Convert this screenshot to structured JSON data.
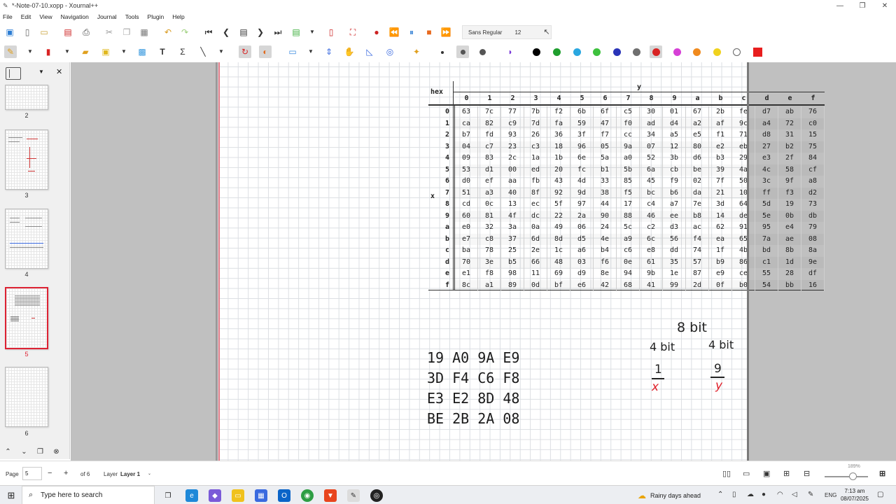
{
  "window": {
    "title": "*-Note-07-10.xopp - Xournal++"
  },
  "menu": [
    "File",
    "Edit",
    "View",
    "Navigation",
    "Journal",
    "Tools",
    "Plugin",
    "Help"
  ],
  "toolbar": {
    "font_name": "Sans Regular",
    "font_size": "12",
    "colors": [
      "#000000",
      "#1f9e2e",
      "#2aa7e0",
      "#3ec13e",
      "#2a34b8",
      "#6f6f6f",
      "#d82323",
      "#d640d6",
      "#f08a1e",
      "#f0d21e",
      "#ffffff"
    ],
    "fill_color": "#e81e1e",
    "selected_color": "#d82323"
  },
  "sidebar": {
    "pages": [
      {
        "num": "2"
      },
      {
        "num": "3"
      },
      {
        "num": "4"
      },
      {
        "num": "5",
        "selected": true
      },
      {
        "num": "6"
      }
    ]
  },
  "sbox": {
    "title": "hex",
    "y_label": "y",
    "x_label": "x",
    "cols": [
      "0",
      "1",
      "2",
      "3",
      "4",
      "5",
      "6",
      "7",
      "8",
      "9",
      "a",
      "b",
      "c",
      "d",
      "e",
      "f"
    ],
    "rows": [
      {
        "h": "0",
        "v": [
          "63",
          "7c",
          "77",
          "7b",
          "f2",
          "6b",
          "6f",
          "c5",
          "30",
          "01",
          "67",
          "2b",
          "fe",
          "d7",
          "ab",
          "76"
        ]
      },
      {
        "h": "1",
        "v": [
          "ca",
          "82",
          "c9",
          "7d",
          "fa",
          "59",
          "47",
          "f0",
          "ad",
          "d4",
          "a2",
          "af",
          "9c",
          "a4",
          "72",
          "c0"
        ]
      },
      {
        "h": "2",
        "v": [
          "b7",
          "fd",
          "93",
          "26",
          "36",
          "3f",
          "f7",
          "cc",
          "34",
          "a5",
          "e5",
          "f1",
          "71",
          "d8",
          "31",
          "15"
        ]
      },
      {
        "h": "3",
        "v": [
          "04",
          "c7",
          "23",
          "c3",
          "18",
          "96",
          "05",
          "9a",
          "07",
          "12",
          "80",
          "e2",
          "eb",
          "27",
          "b2",
          "75"
        ]
      },
      {
        "h": "4",
        "v": [
          "09",
          "83",
          "2c",
          "1a",
          "1b",
          "6e",
          "5a",
          "a0",
          "52",
          "3b",
          "d6",
          "b3",
          "29",
          "e3",
          "2f",
          "84"
        ]
      },
      {
        "h": "5",
        "v": [
          "53",
          "d1",
          "00",
          "ed",
          "20",
          "fc",
          "b1",
          "5b",
          "6a",
          "cb",
          "be",
          "39",
          "4a",
          "4c",
          "58",
          "cf"
        ]
      },
      {
        "h": "6",
        "v": [
          "d0",
          "ef",
          "aa",
          "fb",
          "43",
          "4d",
          "33",
          "85",
          "45",
          "f9",
          "02",
          "7f",
          "50",
          "3c",
          "9f",
          "a8"
        ]
      },
      {
        "h": "7",
        "v": [
          "51",
          "a3",
          "40",
          "8f",
          "92",
          "9d",
          "38",
          "f5",
          "bc",
          "b6",
          "da",
          "21",
          "10",
          "ff",
          "f3",
          "d2"
        ]
      },
      {
        "h": "8",
        "v": [
          "cd",
          "0c",
          "13",
          "ec",
          "5f",
          "97",
          "44",
          "17",
          "c4",
          "a7",
          "7e",
          "3d",
          "64",
          "5d",
          "19",
          "73"
        ]
      },
      {
        "h": "9",
        "v": [
          "60",
          "81",
          "4f",
          "dc",
          "22",
          "2a",
          "90",
          "88",
          "46",
          "ee",
          "b8",
          "14",
          "de",
          "5e",
          "0b",
          "db"
        ]
      },
      {
        "h": "a",
        "v": [
          "e0",
          "32",
          "3a",
          "0a",
          "49",
          "06",
          "24",
          "5c",
          "c2",
          "d3",
          "ac",
          "62",
          "91",
          "95",
          "e4",
          "79"
        ]
      },
      {
        "h": "b",
        "v": [
          "e7",
          "c8",
          "37",
          "6d",
          "8d",
          "d5",
          "4e",
          "a9",
          "6c",
          "56",
          "f4",
          "ea",
          "65",
          "7a",
          "ae",
          "08"
        ]
      },
      {
        "h": "c",
        "v": [
          "ba",
          "78",
          "25",
          "2e",
          "1c",
          "a6",
          "b4",
          "c6",
          "e8",
          "dd",
          "74",
          "1f",
          "4b",
          "bd",
          "8b",
          "8a"
        ]
      },
      {
        "h": "d",
        "v": [
          "70",
          "3e",
          "b5",
          "66",
          "48",
          "03",
          "f6",
          "0e",
          "61",
          "35",
          "57",
          "b9",
          "86",
          "c1",
          "1d",
          "9e"
        ]
      },
      {
        "h": "e",
        "v": [
          "e1",
          "f8",
          "98",
          "11",
          "69",
          "d9",
          "8e",
          "94",
          "9b",
          "1e",
          "87",
          "e9",
          "ce",
          "55",
          "28",
          "df"
        ]
      },
      {
        "h": "f",
        "v": [
          "8c",
          "a1",
          "89",
          "0d",
          "bf",
          "e6",
          "42",
          "68",
          "41",
          "99",
          "2d",
          "0f",
          "b0",
          "54",
          "bb",
          "16"
        ]
      }
    ]
  },
  "notes": {
    "state_matrix": [
      "19 A0 9A E9",
      "3D F4 C6 F8",
      "E3 E2 8D 48",
      "BE 2B 2A 08"
    ],
    "eight_bit": "8 bit",
    "four_bit_left": "4 bit",
    "four_bit_right": "4 bit",
    "digit_left": "1",
    "digit_right": "9",
    "var_left": "x",
    "var_right": "y"
  },
  "statusbar": {
    "page_label": "Page",
    "page_value": "5",
    "page_of": "of 6",
    "layer_label": "Layer",
    "layer_value": "Layer 1",
    "zoom": "189%"
  },
  "taskbar": {
    "search_placeholder": "Type here to search",
    "weather": "Rainy days ahead",
    "lang": "ENG",
    "time": "7:13 am",
    "date": "08/07/2025"
  }
}
